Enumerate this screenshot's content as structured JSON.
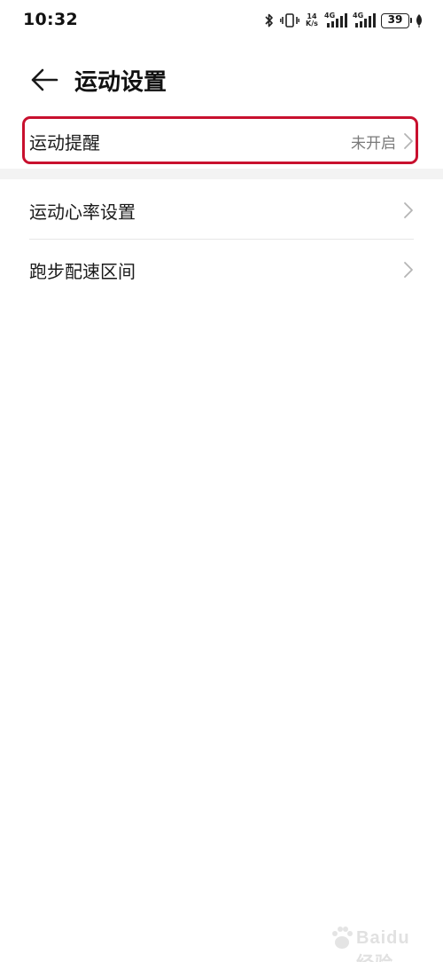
{
  "status_bar": {
    "time": "10:32",
    "net_speed_top": "14",
    "net_speed_bottom": "K/s",
    "signal_label_1": "4G",
    "signal_label_2": "4G",
    "battery": "39",
    "icons": [
      "bluetooth-icon",
      "vibrate-icon",
      "signal-icon",
      "signal-icon",
      "battery-icon",
      "leaf-icon"
    ]
  },
  "header": {
    "title": "运动设置",
    "back_icon": "back-arrow-icon"
  },
  "settings": {
    "reminder": {
      "label": "运动提醒",
      "value": "未开启"
    },
    "heart_rate": {
      "label": "运动心率设置"
    },
    "pace": {
      "label": "跑步配速区间"
    }
  },
  "watermark": {
    "text": "Baidu经验"
  },
  "colors": {
    "highlight": "#c8102e",
    "secondary_text": "#7a7a7a",
    "divider": "#e6e6e6"
  }
}
